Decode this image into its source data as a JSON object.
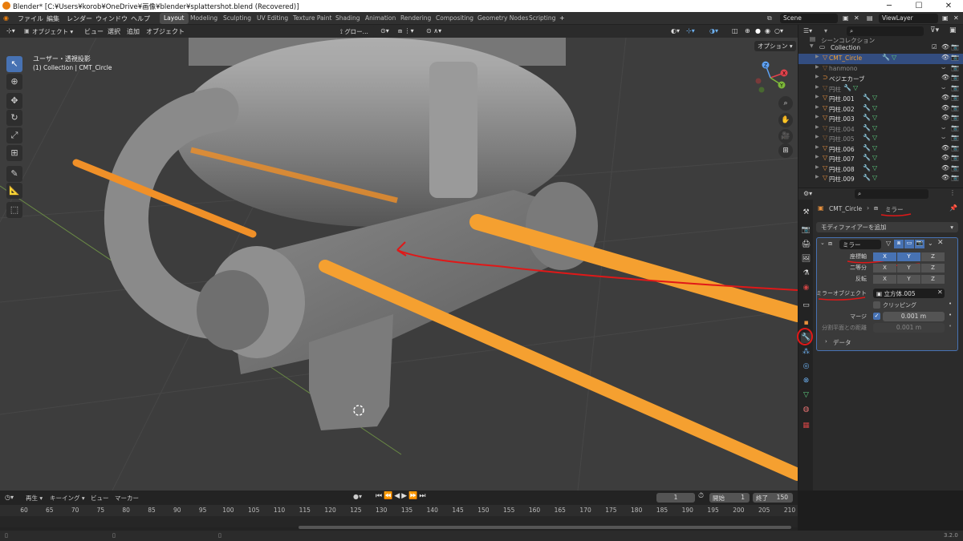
{
  "window": {
    "title": "Blender* [C:¥Users¥korob¥OneDrive¥画像¥blender¥splattershot.blend (Recovered)]",
    "minimize": "─",
    "maximize": "☐",
    "close": "✕"
  },
  "menu": [
    "ファイル",
    "編集",
    "レンダー",
    "ウィンドウ",
    "ヘルプ"
  ],
  "workspaces": [
    {
      "label": "Layout",
      "active": true
    },
    {
      "label": "Modeling"
    },
    {
      "label": "Sculpting"
    },
    {
      "label": "UV Editing"
    },
    {
      "label": "Texture Paint"
    },
    {
      "label": "Shading"
    },
    {
      "label": "Animation"
    },
    {
      "label": "Rendering"
    },
    {
      "label": "Compositing"
    },
    {
      "label": "Geometry Nodes"
    },
    {
      "label": "Scripting"
    }
  ],
  "scene": {
    "name": "Scene",
    "view_layer": "ViewLayer"
  },
  "viewport_header": {
    "mode": "オブジェクト",
    "menus": [
      "ビュー",
      "選択",
      "追加",
      "オブジェクト"
    ],
    "transform": "グロー...",
    "options": "オプション"
  },
  "viewport": {
    "view_name": "ユーザー・透視投影",
    "collection_info": "(1) Collection | CMT_Circle"
  },
  "gizmo": {
    "x": "X",
    "y": "Y",
    "z": "Z"
  },
  "outliner": {
    "header_row": "シーンコレクション",
    "collection": "Collection",
    "items": [
      {
        "name": "CMT_Circle",
        "selected": true
      },
      {
        "name": "hanmono",
        "dim": true
      },
      {
        "name": "ベジエカーブ",
        "curve": true
      },
      {
        "name": "円柱",
        "dim": true
      },
      {
        "name": "円柱.001"
      },
      {
        "name": "円柱.002"
      },
      {
        "name": "円柱.003"
      },
      {
        "name": "円柱.004",
        "dim": true
      },
      {
        "name": "円柱.005",
        "dim": true
      },
      {
        "name": "円柱.006"
      },
      {
        "name": "円柱.007"
      },
      {
        "name": "円柱.008"
      },
      {
        "name": "円柱.009"
      }
    ]
  },
  "properties": {
    "breadcrumb_object": "CMT_Circle",
    "breadcrumb_modifier": "ミラー",
    "add_modifier": "モディファイアーを追加",
    "modifier_name": "ミラー",
    "axis_label": "座標軸",
    "bisect_label": "二等分",
    "flip_label": "反転",
    "axes": [
      "X",
      "Y",
      "Z"
    ],
    "mirror_object_label": "ミラーオブジェクト",
    "mirror_object_value": "立方体.005",
    "clipping_label": "クリッピング",
    "merge_label": "マージ",
    "merge_value": "0.001 m",
    "bisect_distance_label": "分割平面との距離",
    "bisect_distance_value": "0.001 m",
    "data_panel": "データ"
  },
  "timeline": {
    "playback": "再生",
    "keying": "キーイング",
    "view": "ビュー",
    "marker": "マーカー",
    "current_frame": "1",
    "start_label": "開始",
    "start": "1",
    "end_label": "終了",
    "end": "150",
    "ticks": [
      "60",
      "65",
      "70",
      "75",
      "80",
      "85",
      "90",
      "95",
      "100",
      "105",
      "110",
      "115",
      "120",
      "125",
      "130",
      "135",
      "140",
      "145",
      "150",
      "155",
      "160",
      "165",
      "170",
      "175",
      "180",
      "185",
      "190",
      "195",
      "200",
      "205",
      "210"
    ]
  },
  "status": {
    "version": "3.2.0"
  },
  "colors": {
    "accent": "#4772b3",
    "selected_orange": "#f5a030",
    "annotation_red": "#e01818"
  }
}
